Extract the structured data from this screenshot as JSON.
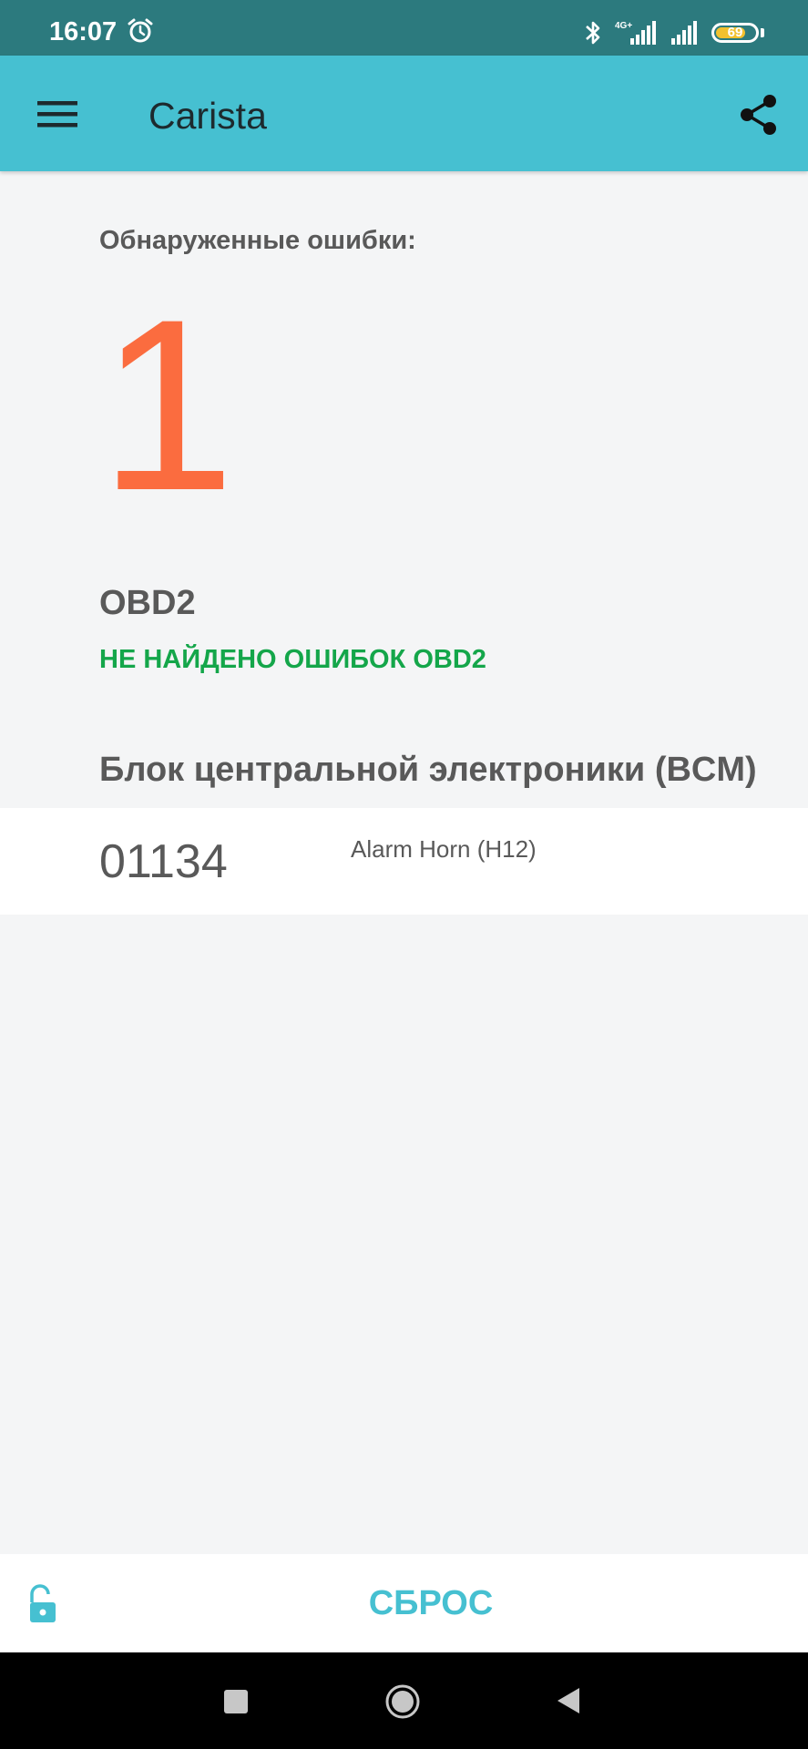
{
  "status_bar": {
    "time": "16:07",
    "alarm_icon": "alarm-clock-icon",
    "bluetooth_icon": "bluetooth-icon",
    "network_label": "4G+",
    "signal_icon": "signal-bars-icon",
    "battery_level": "69"
  },
  "app_bar": {
    "title": "Carista",
    "menu_icon": "hamburger-menu-icon",
    "share_icon": "share-icon",
    "color": "#46c0d1"
  },
  "content": {
    "errors_label": "Обнаруженные ошибки:",
    "errors_count": "1",
    "obd": {
      "title": "OBD2",
      "status": "НЕ НАЙДЕНО ОШИБОК OBD2"
    },
    "bcm": {
      "title": "Блок центральной электроники (BCM)",
      "errors": [
        {
          "code": "01134",
          "description": "Alarm Horn (H12)"
        }
      ]
    }
  },
  "bottom_bar": {
    "lock_icon": "unlocked-padlock-icon",
    "reset_label": "СБРОС"
  },
  "nav_bar": {
    "recent_icon": "square-icon",
    "home_icon": "circle-icon",
    "back_icon": "triangle-back-icon"
  },
  "colors": {
    "status_bar": "#2c7a7e",
    "accent": "#46c0d1",
    "error_count": "#fb6c3f",
    "ok_status": "#14a64a",
    "text": "#595959",
    "background": "#f4f5f6"
  }
}
